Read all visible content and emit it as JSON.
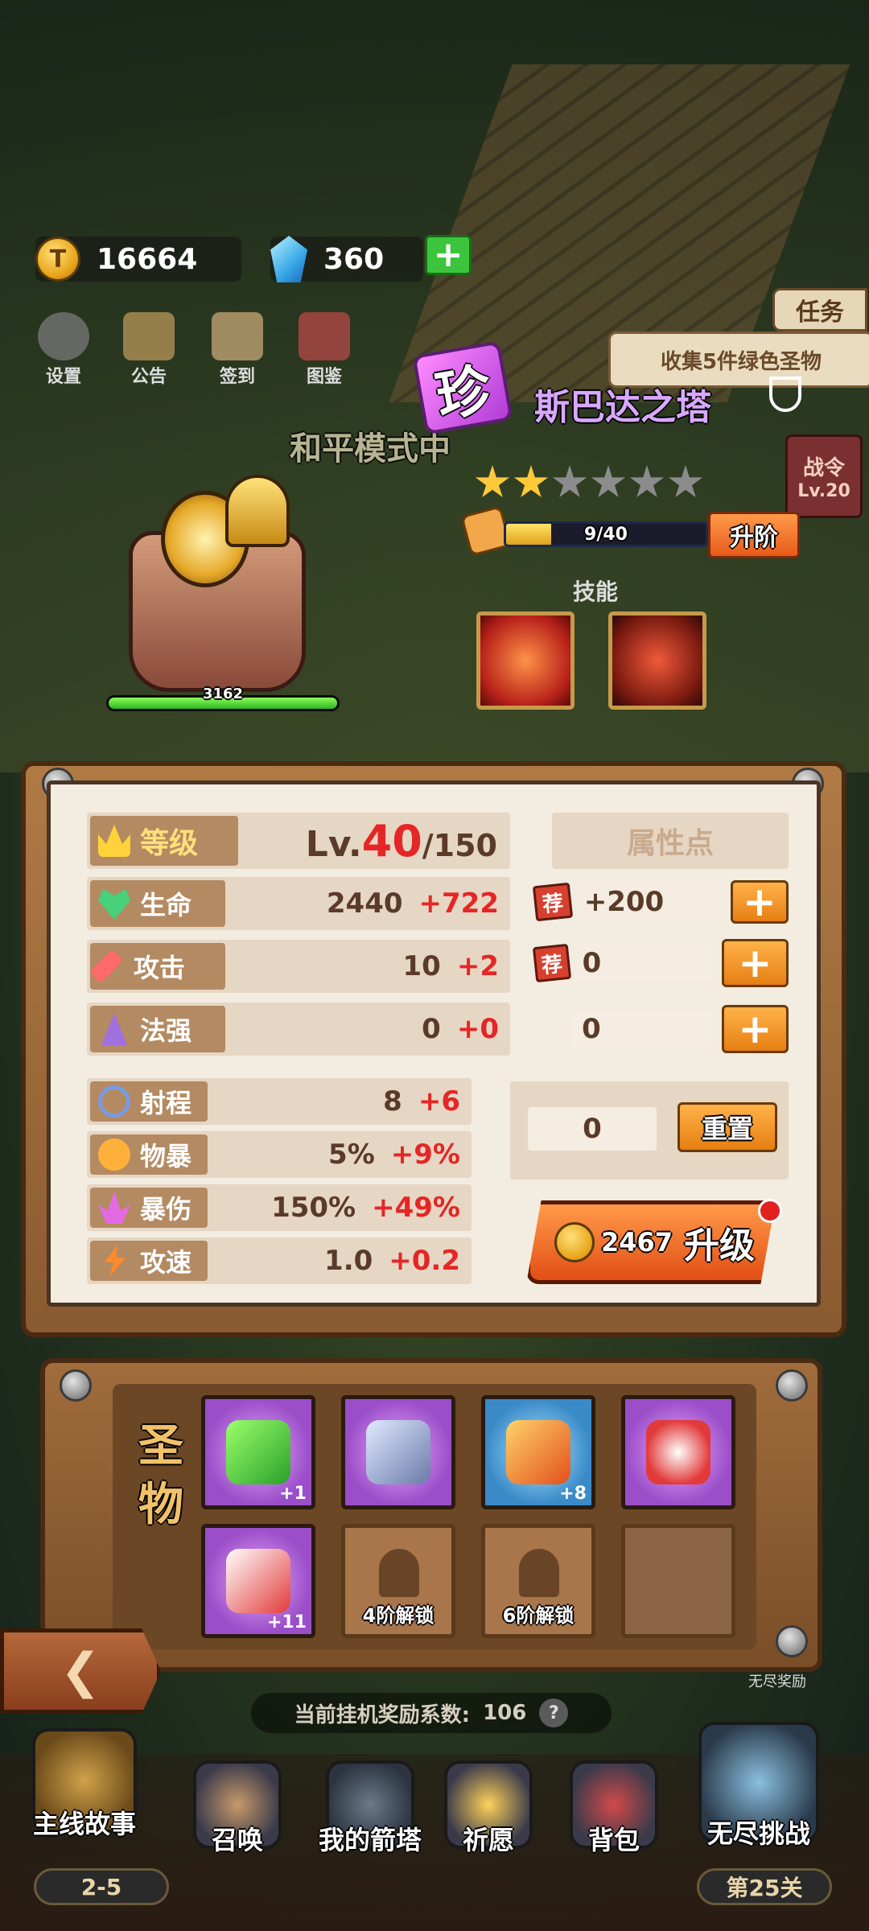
{
  "resources": {
    "gold": "16664",
    "gems": "360"
  },
  "top_icons": [
    {
      "icon": "gear-icon",
      "label": "设置"
    },
    {
      "icon": "notice-icon",
      "label": "公告"
    },
    {
      "icon": "sign-in-icon",
      "label": "签到"
    },
    {
      "icon": "book-icon",
      "label": "图鉴"
    }
  ],
  "quest": {
    "tab_label": "任务",
    "text": "收集5件绿色圣物"
  },
  "battle_pass": {
    "label": "战令",
    "level": "Lv.20"
  },
  "hero": {
    "rarity": "珍",
    "name": "斯巴达之塔",
    "stars": {
      "filled": 2,
      "total": 6
    },
    "shard_progress": "9/40",
    "shard_fraction": 0.225,
    "tier_up_label": "升阶",
    "skills_label": "技能",
    "hp_value": "3162",
    "mode_text": "和平模式中"
  },
  "stats": {
    "level": {
      "label": "等级",
      "prefix": "Lv.",
      "current": "40",
      "max": "/150"
    },
    "main": [
      {
        "label": "生命",
        "icon": "heart-icon",
        "value": "2440",
        "bonus": "+722"
      },
      {
        "label": "攻击",
        "icon": "sword-icon",
        "value": "10",
        "bonus": "+2"
      },
      {
        "label": "法强",
        "icon": "wizard-hat-icon",
        "value": "0",
        "bonus": "+0"
      }
    ],
    "secondary": [
      {
        "label": "射程",
        "icon": "crosshair-icon",
        "value": "8",
        "bonus": "+6"
      },
      {
        "label": "物暴",
        "icon": "crit-icon",
        "value": "5%",
        "bonus": "+9%"
      },
      {
        "label": "暴伤",
        "icon": "crystal-icon",
        "value": "150%",
        "bonus": "+49%"
      },
      {
        "label": "攻速",
        "icon": "lightning-icon",
        "value": "1.0",
        "bonus": "+0.2"
      }
    ]
  },
  "attributes": {
    "title": "属性点",
    "rows": [
      {
        "recommended": "荐",
        "value": "+200"
      },
      {
        "recommended": "荐",
        "value": "0"
      },
      {
        "recommended": "",
        "value": "0"
      }
    ],
    "free_points": "0",
    "reset_label": "重置"
  },
  "upgrade": {
    "cost": "2467",
    "label": "升级"
  },
  "relics": {
    "title_line1": "圣",
    "title_line2": "物",
    "slots": [
      {
        "type": "purple",
        "item": "syringe-icon",
        "count": "+1"
      },
      {
        "type": "purple",
        "item": "chain-icon",
        "count": ""
      },
      {
        "type": "blue",
        "item": "feather-icon",
        "count": "+8"
      },
      {
        "type": "purple",
        "item": "apple-icon",
        "count": ""
      },
      {
        "type": "purple",
        "item": "rocket-icon",
        "count": "+11"
      },
      {
        "type": "locked",
        "label": "4阶解锁"
      },
      {
        "type": "locked",
        "label": "6阶解锁"
      },
      {
        "type": "empty"
      }
    ]
  },
  "endless_reward_tag": "无尽奖励",
  "idle_reward": {
    "label": "当前挂机奖励系数:",
    "value": "106",
    "help": "?"
  },
  "nav": [
    {
      "label": "主线故事",
      "sub": "2-5",
      "icon": "story-book-icon"
    },
    {
      "label": "召唤",
      "icon": "summon-scroll-icon"
    },
    {
      "label": "我的箭塔",
      "icon": "tower-icon"
    },
    {
      "label": "祈愿",
      "icon": "star-badge-icon"
    },
    {
      "label": "背包",
      "icon": "backpack-icon"
    },
    {
      "label": "无尽挑战",
      "sub": "第25关",
      "icon": "sword-crest-icon"
    }
  ]
}
